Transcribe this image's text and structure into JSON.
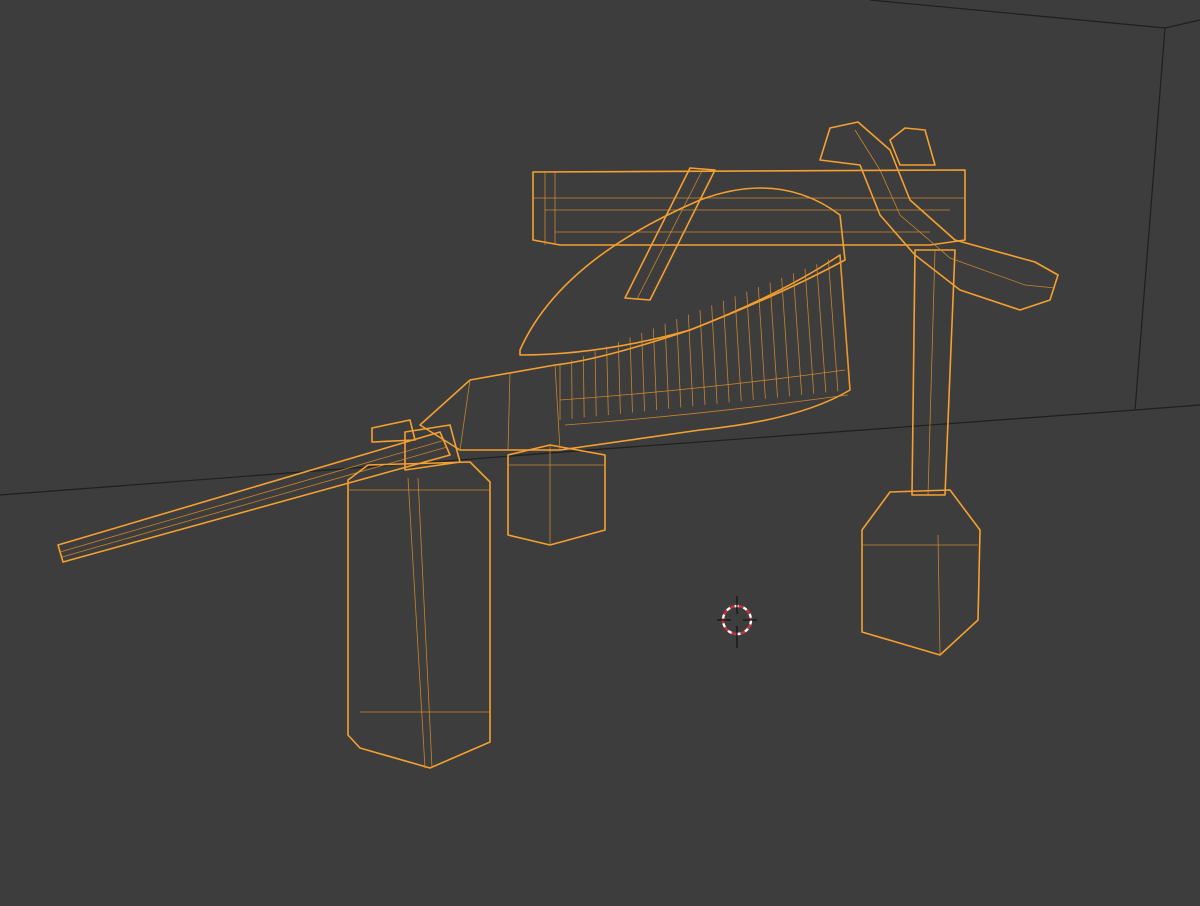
{
  "viewport": {
    "mode": "wireframe",
    "background_color": "#3d3d3d",
    "selection_outline_color": "#f5a030",
    "wire_color": "#e0902a",
    "room_edge_color": "#1f1f1f"
  },
  "icons": {
    "cursor": "3d-cursor-icon"
  }
}
